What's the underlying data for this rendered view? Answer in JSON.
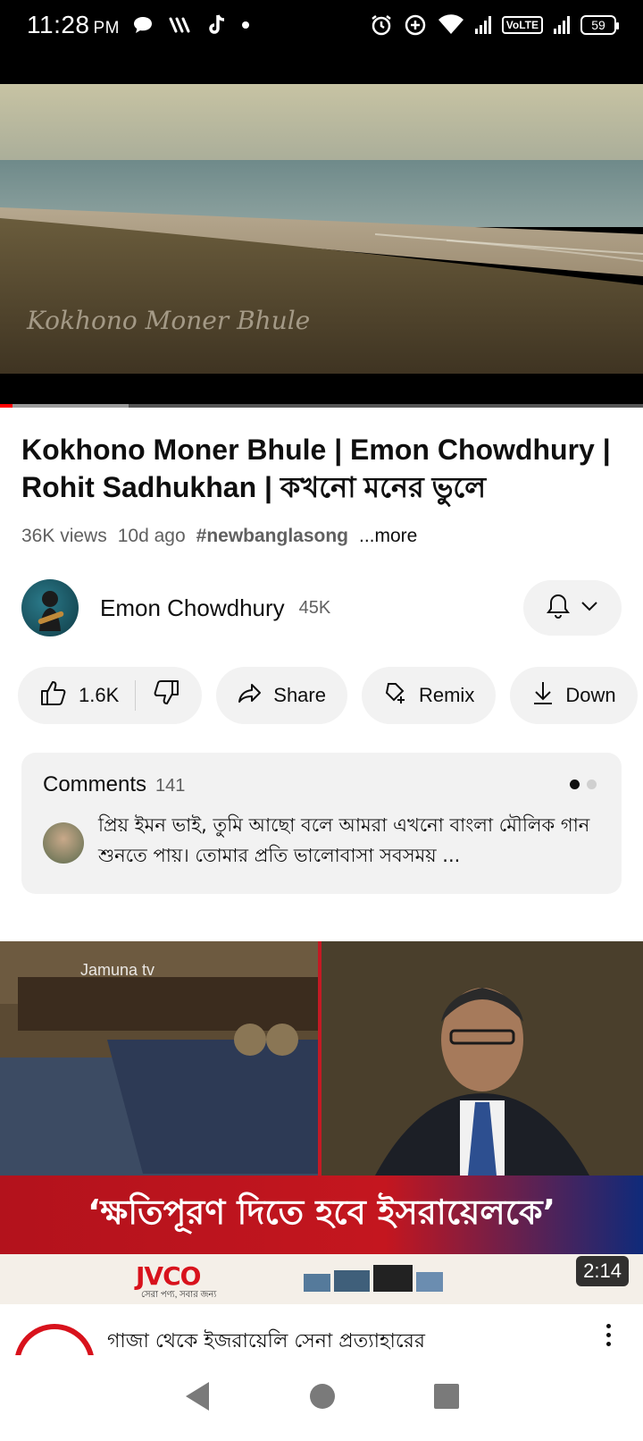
{
  "status_bar": {
    "time": "11:28",
    "ampm": "PM",
    "volte": "VoLTE",
    "battery": "59"
  },
  "player": {
    "watermark": "Kokhono Moner Bhule",
    "progress_fraction": 0.2,
    "buffer_fraction": 0.2
  },
  "video": {
    "title": "Kokhono Moner Bhule | Emon Chowdhury | Rohit Sadhukhan | কখনো মনের ভুলে",
    "views": "36K views",
    "age": "10d ago",
    "hashtag": "#newbanglasong",
    "more": "...more"
  },
  "channel": {
    "name": "Emon Chowdhury",
    "subscribers": "45K"
  },
  "actions": {
    "like_count": "1.6K",
    "share": "Share",
    "remix": "Remix",
    "download": "Down"
  },
  "comments": {
    "label": "Comments",
    "count": "141",
    "top_comment": "প্রিয় ইমন ভাই, তুমি আছো বলে আমরা এখনো বাংলা মৌলিক গান শুনতে পায়। তোমার প্রতি ভালোবাসা সবসময় ..."
  },
  "next_video": {
    "caption": "‘ক্ষতিপূরণ দিতে হবে ইসরায়েলকে’",
    "channel_logo": "Jamuna tv",
    "sponsor": "JVCO",
    "sponsor_tagline": "সেরা পণ্য, সবার জন্য",
    "duration": "2:14",
    "title": "গাজা থেকে ইজরায়েলি সেনা প্রত্যাহারের"
  },
  "colors": {
    "accent": "#ff0000",
    "pill_bg": "#f2f2f2",
    "text_secondary": "#606060"
  },
  "icons": [
    "chat-bubble-icon",
    "wifi-calling-icon",
    "tiktok-icon",
    "alarm-icon",
    "data-saver-icon",
    "wifi-icon",
    "signal-icon",
    "battery-icon",
    "bell-icon",
    "chevron-down-icon",
    "thumbs-up-icon",
    "thumbs-down-icon",
    "share-icon",
    "remix-icon",
    "download-icon",
    "more-vert-icon",
    "nav-back-icon",
    "nav-home-icon",
    "nav-recents-icon"
  ]
}
